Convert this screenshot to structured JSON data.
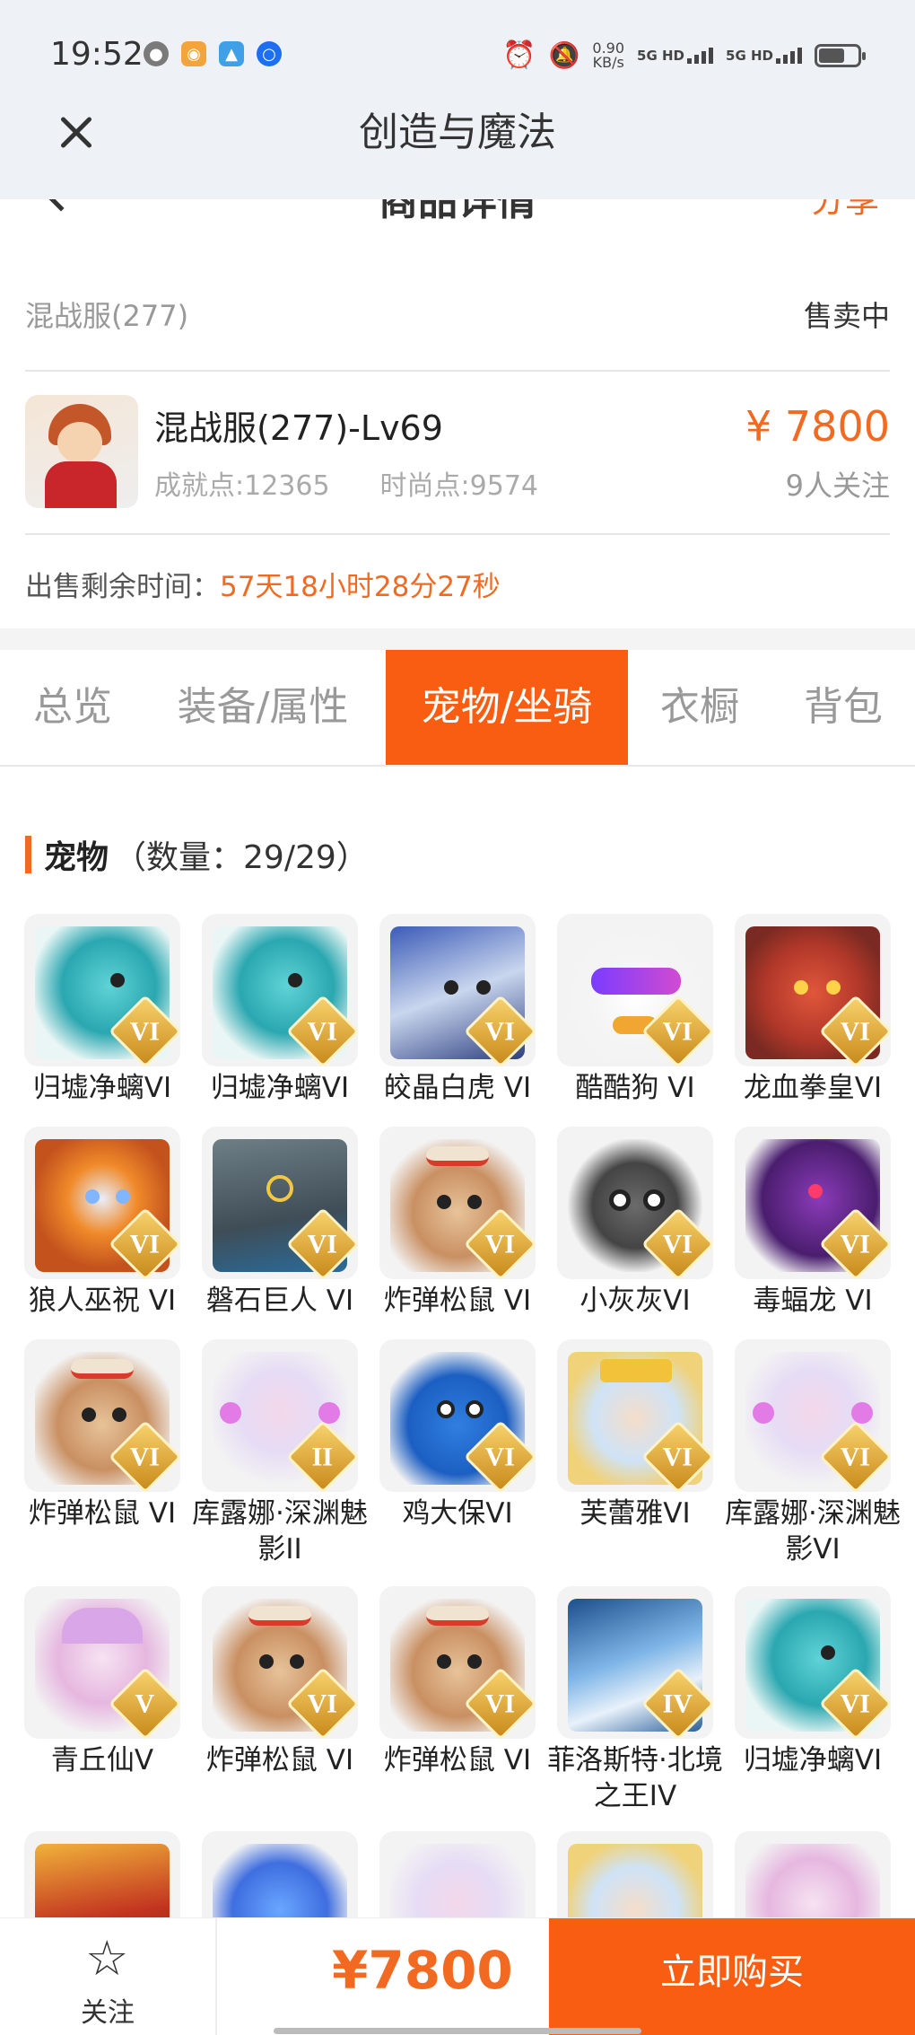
{
  "status_bar": {
    "time": "19:52",
    "net_speed": "0.90",
    "net_unit": "KB/s",
    "sig1": "5G HD",
    "sig2": "5G HD",
    "icons": [
      "wechat-icon",
      "weibo-icon",
      "app-icon",
      "browser-icon",
      "alarm-icon",
      "mute-icon",
      "battery-icon"
    ]
  },
  "titlebar": {
    "title": "创造与魔法"
  },
  "page_header": {
    "title": "商品详情",
    "share": "分享"
  },
  "seller": {
    "server": "混战服(277)",
    "status": "售卖中"
  },
  "item": {
    "name": "混战服(277)-Lv69",
    "achievement": "成就点:12365",
    "fashion": "时尚点:9574",
    "price": "¥ 7800",
    "followers": "9人关注"
  },
  "remaining": {
    "label": "出售剩余时间：",
    "value": "57天18小时28分27秒"
  },
  "tabs": [
    {
      "label": "总览"
    },
    {
      "label": "装备/属性"
    },
    {
      "label": "宠物/坐骑"
    },
    {
      "label": "衣橱"
    },
    {
      "label": "背包"
    }
  ],
  "section": {
    "title": "宠物",
    "count": "（数量：29/29）"
  },
  "pets": [
    {
      "name": "归墟净螭VI",
      "badge": "VI"
    },
    {
      "name": "归墟净螭VI",
      "badge": "VI"
    },
    {
      "name": "皎晶白虎 VI",
      "badge": "VI"
    },
    {
      "name": "酷酷狗 VI",
      "badge": "VI"
    },
    {
      "name": "龙血拳皇VI",
      "badge": "VI"
    },
    {
      "name": "狼人巫祝 VI",
      "badge": "VI"
    },
    {
      "name": "磐石巨人 VI",
      "badge": "VI"
    },
    {
      "name": "炸弹松鼠 VI",
      "badge": "VI"
    },
    {
      "name": "小灰灰VI",
      "badge": "VI"
    },
    {
      "name": "毒蝠龙 VI",
      "badge": "VI"
    },
    {
      "name": "炸弹松鼠 VI",
      "badge": "VI"
    },
    {
      "name": "库露娜·深渊魅影II",
      "badge": "II"
    },
    {
      "name": "鸡大保VI",
      "badge": "VI"
    },
    {
      "name": "芙蕾雅VI",
      "badge": "VI"
    },
    {
      "name": "库露娜·深渊魅影VI",
      "badge": "VI"
    },
    {
      "name": "青丘仙V",
      "badge": "V"
    },
    {
      "name": "炸弹松鼠 VI",
      "badge": "VI"
    },
    {
      "name": "炸弹松鼠 VI",
      "badge": "VI"
    },
    {
      "name": "菲洛斯特·北境之王IV",
      "badge": "IV"
    },
    {
      "name": "归墟净螭VI",
      "badge": "VI"
    }
  ],
  "bottom": {
    "fav_label": "关注",
    "price": "¥7800",
    "buy_label": "立即购买"
  }
}
